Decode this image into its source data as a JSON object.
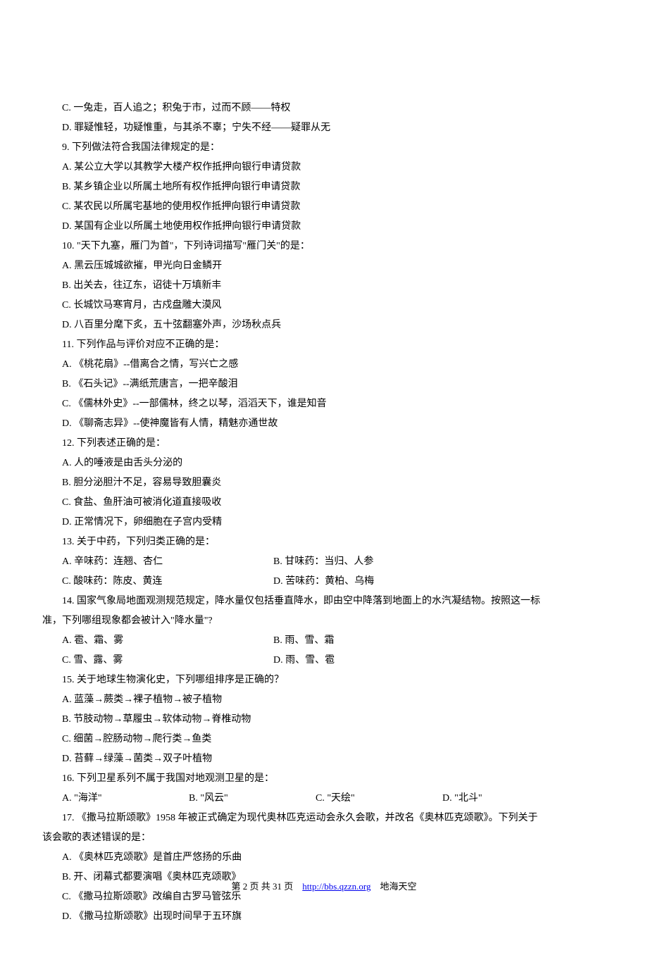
{
  "orphan_options": {
    "c": "C. 一兔走，百人追之；积兔于市，过而不顾——特权",
    "d": "D. 罪疑惟轻，功疑惟重，与其杀不辜；宁失不经——疑罪从无"
  },
  "q9": {
    "stem": "9. 下列做法符合我国法律规定的是：",
    "a": "A. 某公立大学以其教学大楼产权作抵押向银行申请贷款",
    "b": "B. 某乡镇企业以所属土地所有权作抵押向银行申请贷款",
    "c": "C. 某农民以所属宅基地的使用权作抵押向银行申请贷款",
    "d": "D. 某国有企业以所属土地使用权作抵押向银行申请贷款"
  },
  "q10": {
    "stem": "10. \"天下九塞，雁门为首\"，下列诗词描写\"雁门关\"的是：",
    "a": "A. 黑云压城城欲摧，甲光向日金鳞开",
    "b": "B. 出关去，往辽东，诏徒十万填新丰",
    "c": "C. 长城饮马寒宵月，古戍盘雕大漠风",
    "d": "D. 八百里分麾下炙，五十弦翻塞外声，沙场秋点兵"
  },
  "q11": {
    "stem": "11. 下列作品与评价对应不正确的是：",
    "a": "A. 《桃花扇》--借离合之情，写兴亡之感",
    "b": "B. 《石头记》--满纸荒唐言，一把辛酸泪",
    "c": "C. 《儒林外史》--一部儒林，终之以琴，滔滔天下，谁是知音",
    "d": "D. 《聊斋志异》--使神魔皆有人情，精魅亦通世故"
  },
  "q12": {
    "stem": "12. 下列表述正确的是：",
    "a": "A. 人的唾液是由舌头分泌的",
    "b": "B. 胆分泌胆汁不足，容易导致胆囊炎",
    "c": "C. 食盐、鱼肝油可被消化道直接吸收",
    "d": "D. 正常情况下，卵细胞在子宫内受精"
  },
  "q13": {
    "stem": "13. 关于中药，下列归类正确的是：",
    "a": "A. 辛味药：连翘、杏仁",
    "b": "B. 甘味药：当归、人参",
    "c": "C. 酸味药：陈皮、黄连",
    "d": "D. 苦味药：黄柏、乌梅"
  },
  "q14": {
    "stem": "14. 国家气象局地面观测规范规定，降水量仅包括垂直降水，即由空中降落到地面上的水汽凝结物。按照这一标",
    "stem2": "准，下列哪组现象都会被计入\"降水量\"?",
    "a": "A. 雹、霜、雾",
    "b": "B. 雨、雪、霜",
    "c": "C. 雪、露、雾",
    "d": "D. 雨、雪、雹"
  },
  "q15": {
    "stem": "15. 关于地球生物演化史，下列哪组排序是正确的？",
    "a": "A. 蓝藻→蕨类→裸子植物→被子植物",
    "b": "B. 节肢动物→草履虫→软体动物→脊椎动物",
    "c": "C. 细菌→腔肠动物→爬行类→鱼类",
    "d": "D. 苔藓→绿藻→菌类→双子叶植物"
  },
  "q16": {
    "stem": "16. 下列卫星系列不属于我国对地观测卫星的是：",
    "a": "A. \"海洋\"",
    "b": "B. \"风云\"",
    "c": "C. \"天绘\"",
    "d": "D. \"北斗\""
  },
  "q17": {
    "stem": "17. 《撒马拉斯颂歌》1958 年被正式确定为现代奥林匹克运动会永久会歌，并改名《奥林匹克颂歌》。下列关于",
    "stem2": "该会歌的表述错误的是：",
    "a": "A. 《奥林匹克颂歌》是首庄严悠扬的乐曲",
    "b": "B. 开、闭幕式都要演唱《奥林匹克颂歌》",
    "c": "C. 《撒马拉斯颂歌》改编自古罗马管弦乐",
    "d": "D. 《撒马拉斯颂歌》出现时间早于五环旗"
  },
  "footer": {
    "page_current": "2",
    "page_total": "31",
    "prefix": "第",
    "mid": "页 共",
    "suffix": "页",
    "url": "http://bbs.qzzn.org",
    "site_name": "地海天空"
  }
}
